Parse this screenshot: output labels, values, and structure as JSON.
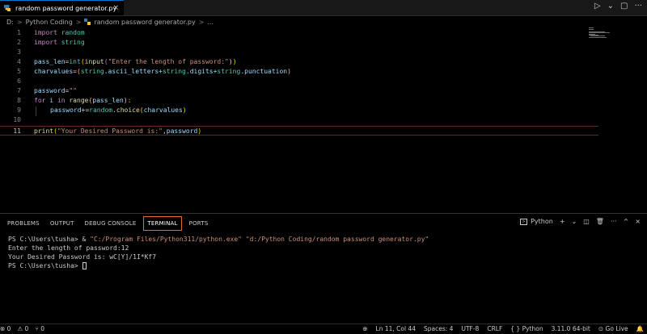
{
  "tab": {
    "label": "random password generator.py",
    "close": "×"
  },
  "title_actions": {
    "run": "▷",
    "run_menu": "⌄",
    "split": "▢",
    "more": "···"
  },
  "breadcrumb": {
    "drive": "D:",
    "sep": ">",
    "folder": "Python Coding",
    "file": "random password generator.py",
    "more": "..."
  },
  "editor": {
    "line_numbers": [
      "1",
      "2",
      "3",
      "4",
      "5",
      "6",
      "7",
      "8",
      "9",
      "10",
      "11"
    ],
    "code": {
      "l1_kw": "import",
      "l1_mod": "random",
      "l2_kw": "import",
      "l2_mod": "string",
      "l4_var": "pass_len",
      "l4_eq": "=",
      "l4_fn1": "int",
      "l4_p1": "(",
      "l4_fn2": "input",
      "l4_p2": "(",
      "l4_str": "\"Enter the length of password:\"",
      "l4_p3": "))",
      "l5_var": "charvalues",
      "l5_eq": "=(",
      "l5_a": "string",
      "l5_b": ".ascii_letters+",
      "l5_c": "string",
      "l5_d": ".digits+",
      "l5_e": "string",
      "l5_f": ".punctuation",
      "l5_g": ")",
      "l7_var": "password",
      "l7_eq": "=",
      "l7_str": "\"\"",
      "l8_kw": "for",
      "l8_i": " i ",
      "l8_in": "in",
      "l8_fn": " range",
      "l8_p1": "(",
      "l8_v": "pass_len",
      "l8_p2": "):",
      "l9_var": "password",
      "l9_op": "+=",
      "l9_mod": "random",
      "l9_fn": ".choice",
      "l9_p1": "(",
      "l9_v": "charvalues",
      "l9_p2": ")",
      "l11_fn": "print",
      "l11_p1": "(",
      "l11_str": "\"Your Desired Password is:\"",
      "l11_c": ",",
      "l11_v": "password",
      "l11_p2": ")"
    }
  },
  "panel": {
    "tabs": [
      "PROBLEMS",
      "OUTPUT",
      "DEBUG CONSOLE",
      "TERMINAL",
      "PORTS"
    ],
    "active_tab": "TERMINAL",
    "profile": "Python",
    "actions": {
      "add": "+",
      "dropdown": "⌄",
      "split": "◫",
      "trash": "🗑",
      "more": "···",
      "maximize": "^",
      "close": "×"
    }
  },
  "terminal": {
    "l1_prompt": "PS C:\\Users\\tusha> & ",
    "l1_exe": "\"C:/Program Files/Python311/python.exe\"",
    "l1_space": " ",
    "l1_script": "\"d:/Python Coding/random password generator.py\"",
    "l2": "Enter the length of password:12",
    "l3": "Your Desired Password is: wC[Y]/1I*Kf7",
    "l4_prompt": "PS C:\\Users\\tusha> "
  },
  "status": {
    "errors": "⊗ 0",
    "warnings": "⚠ 0",
    "ports": "⑂ 0",
    "zoom_icon": "⊕",
    "position": "Ln 11, Col 44",
    "spaces": "Spaces: 4",
    "encoding": "UTF-8",
    "eol": "CRLF",
    "language": "{ } Python",
    "interpreter": "3.11.0 64-bit",
    "golive": "⊙ Go Live",
    "bell": "🔔"
  },
  "colors": {
    "accent": "#0078d4",
    "active_tab_border": "#e06c2a",
    "keyword": "#c586c0",
    "string": "#ce9178",
    "function": "#dcdcaa"
  }
}
